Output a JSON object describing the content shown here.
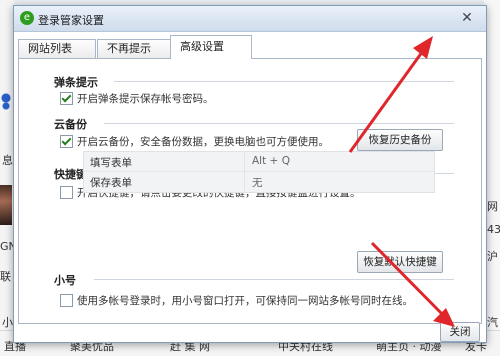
{
  "background": {
    "fragments_left": [
      "息",
      "GN",
      "联",
      "小"
    ],
    "fragments_right": [
      "网",
      "43",
      "沪",
      "汽"
    ],
    "bottom_items": [
      "直播",
      "聚美优品",
      "赶 集 网",
      "中关村在线",
      "萌主页 · 动漫",
      "发卡",
      "汽"
    ]
  },
  "dialog": {
    "title": "登录管家设置",
    "logo_glyph": "e",
    "close_glyph": "✕",
    "tabs": [
      {
        "label": "网站列表",
        "active": false
      },
      {
        "label": "不再提示",
        "active": false
      },
      {
        "label": "高级设置",
        "active": true
      }
    ],
    "sections": {
      "popup": {
        "title": "弹条提示",
        "option": {
          "label": "开启弹条提示保存帐号密码。",
          "checked": true
        }
      },
      "cloud": {
        "title": "云备份",
        "option": {
          "label": "开启云备份，安全备份数据，更换电脑也可方便使用。",
          "checked": true
        },
        "button": "恢复历史备份"
      },
      "hotkey": {
        "title": "快捷键",
        "option": {
          "label": "开启快捷键，请点击要更改的快捷键，直接按键盘进行设置。",
          "checked": false
        },
        "rows": [
          {
            "name": "填写表单",
            "key": "Alt + Q"
          },
          {
            "name": "保存表单",
            "key": "无"
          }
        ],
        "button": "恢复默认快捷键"
      },
      "sub_account": {
        "title": "小号",
        "option": {
          "label": "使用多帐号登录时，用小号窗口打开，可保持同一网站多帐号同时在线。",
          "checked": false
        }
      }
    },
    "close_button": "关闭"
  },
  "annotation": {
    "color": "#e0262a"
  }
}
